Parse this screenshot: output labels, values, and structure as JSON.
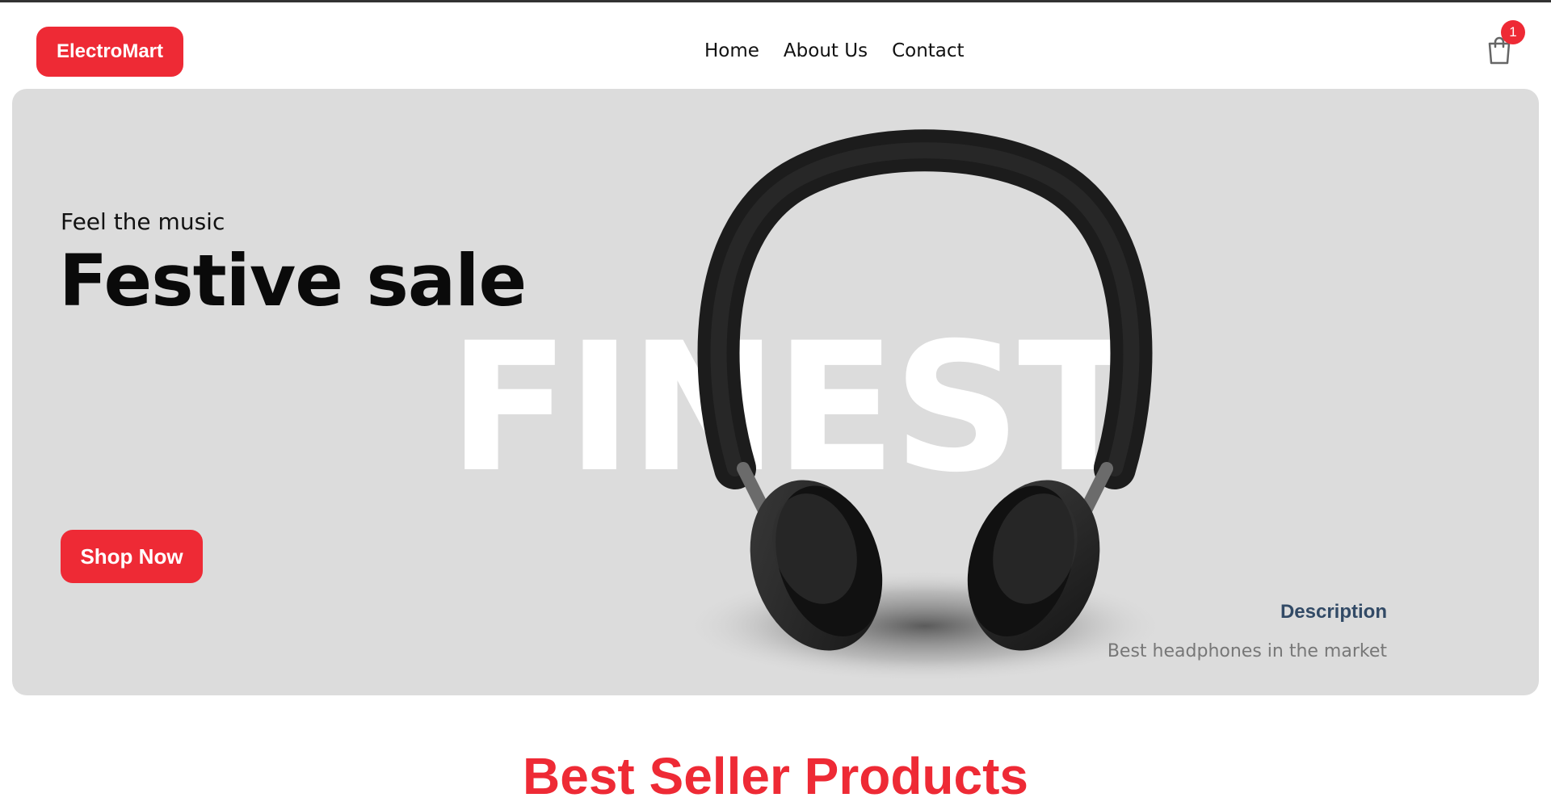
{
  "header": {
    "logo_text": "ElectroMart",
    "nav": [
      {
        "label": "Home"
      },
      {
        "label": "About Us"
      },
      {
        "label": "Contact"
      }
    ],
    "cart_count": "1",
    "cart_icon": "shopping-bag-icon"
  },
  "hero": {
    "subtitle": "Feel the music",
    "title": "Festive sale",
    "background_word": "FINEST",
    "cta_label": "Shop Now",
    "product_image": "headphones-image",
    "description_title": "Description",
    "description_text": "Best headphones in the market"
  },
  "section": {
    "title": "Best Seller Products"
  },
  "colors": {
    "accent": "#ee2a35",
    "hero_bg": "#dcdcdc",
    "description_title": "#324a66"
  }
}
